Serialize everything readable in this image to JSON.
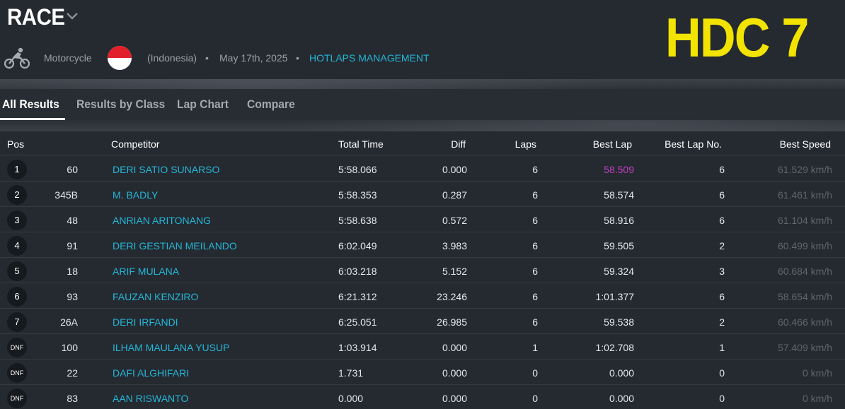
{
  "header": {
    "title": "RACE",
    "brand": "HDC 7",
    "category": "Motorcycle",
    "country": "(Indonesia)",
    "separator": "•",
    "date": "May 17th, 2025",
    "organizer": "HOTLAPS MANAGEMENT"
  },
  "icons": {
    "sport": "motorcycle-icon",
    "flag": "indonesia-flag-icon",
    "dropdown": "chevron-down-icon"
  },
  "colors": {
    "brand": "#f2e400",
    "link": "#24b6d6",
    "best_lap_highlight": "#c43fc0",
    "background": "#252a31"
  },
  "tabs": [
    {
      "label": "All Results",
      "active": true
    },
    {
      "label": "Results by Class",
      "active": false
    },
    {
      "label": "Lap Chart",
      "active": false
    },
    {
      "label": "Compare",
      "active": false
    }
  ],
  "columns": {
    "pos": "Pos",
    "competitor": "Competitor",
    "total_time": "Total Time",
    "diff": "Diff",
    "laps": "Laps",
    "best_lap": "Best Lap",
    "best_lap_no": "Best Lap No.",
    "best_speed": "Best Speed"
  },
  "rows": [
    {
      "pos": "1",
      "num": "60",
      "name": "DERI SATIO SUNARSO",
      "total": "5:58.066",
      "diff": "0.000",
      "laps": "6",
      "best": "58.509",
      "best_no": "6",
      "speed": "61.529 km/h"
    },
    {
      "pos": "2",
      "num": "345B",
      "name": "M. BADLY",
      "total": "5:58.353",
      "diff": "0.287",
      "laps": "6",
      "best": "58.574",
      "best_no": "6",
      "speed": "61.461 km/h"
    },
    {
      "pos": "3",
      "num": "48",
      "name": "ANRIAN ARITONANG",
      "total": "5:58.638",
      "diff": "0.572",
      "laps": "6",
      "best": "58.916",
      "best_no": "6",
      "speed": "61.104 km/h"
    },
    {
      "pos": "4",
      "num": "91",
      "name": "DERI GESTIAN MEILANDO",
      "total": "6:02.049",
      "diff": "3.983",
      "laps": "6",
      "best": "59.505",
      "best_no": "2",
      "speed": "60.499 km/h"
    },
    {
      "pos": "5",
      "num": "18",
      "name": "ARIF MULANA",
      "total": "6:03.218",
      "diff": "5.152",
      "laps": "6",
      "best": "59.324",
      "best_no": "3",
      "speed": "60.684 km/h"
    },
    {
      "pos": "6",
      "num": "93",
      "name": "FAUZAN KENZIRO",
      "total": "6:21.312",
      "diff": "23.246",
      "laps": "6",
      "best": "1:01.377",
      "best_no": "6",
      "speed": "58.654 km/h"
    },
    {
      "pos": "7",
      "num": "26A",
      "name": "DERI IRFANDI",
      "total": "6:25.051",
      "diff": "26.985",
      "laps": "6",
      "best": "59.538",
      "best_no": "2",
      "speed": "60.466 km/h"
    },
    {
      "pos": "DNF",
      "num": "100",
      "name": "ILHAM MAULANA YUSUP",
      "total": "1:03.914",
      "diff": "0.000",
      "laps": "1",
      "best": "1:02.708",
      "best_no": "1",
      "speed": "57.409 km/h"
    },
    {
      "pos": "DNF",
      "num": "22",
      "name": "DAFI ALGHIFARI",
      "total": "1.731",
      "diff": "0.000",
      "laps": "0",
      "best": "0.000",
      "best_no": "0",
      "speed": "0 km/h"
    },
    {
      "pos": "DNF",
      "num": "83",
      "name": "AAN RISWANTO",
      "total": "0.000",
      "diff": "0.000",
      "laps": "0",
      "best": "0.000",
      "best_no": "0",
      "speed": "0 km/h"
    }
  ]
}
